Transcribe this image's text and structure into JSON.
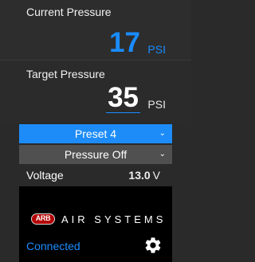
{
  "current": {
    "label": "Current Pressure",
    "value": "17",
    "unit": "PSI"
  },
  "target": {
    "label": "Target Pressure",
    "value": "35",
    "unit": "PSI"
  },
  "preset_select": {
    "value": "Preset 4"
  },
  "mode_select": {
    "value": "Pressure Off"
  },
  "voltage": {
    "label": "Voltage",
    "value": "13.0",
    "unit": "V"
  },
  "brand": {
    "logo_text": "ARB",
    "name": "AIR SYSTEMS"
  },
  "status": {
    "text": "Connected"
  },
  "colors": {
    "accent": "#1a8cff",
    "preset_bg": "#1d8cf8",
    "background": "#2a2a2a"
  },
  "icons": {
    "settings": "gear-icon",
    "dropdown": "chevron-down-icon"
  }
}
